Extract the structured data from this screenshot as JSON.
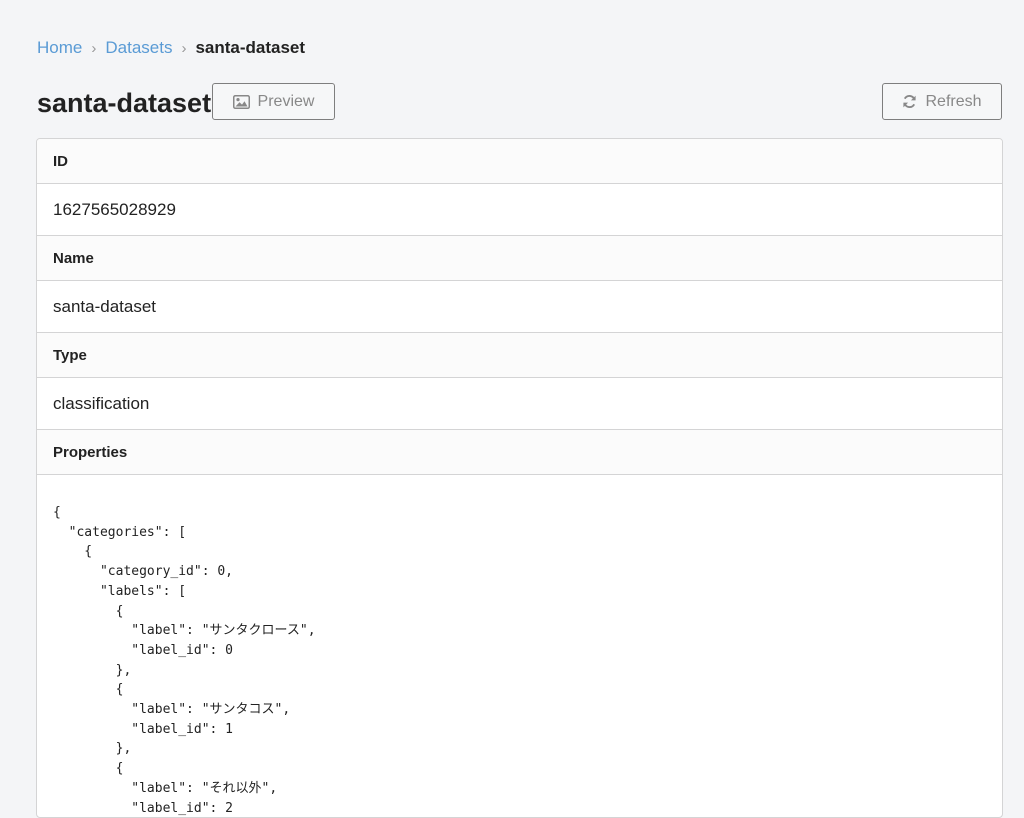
{
  "breadcrumb": {
    "home": "Home",
    "datasets": "Datasets",
    "current": "santa-dataset",
    "separator": "›"
  },
  "header": {
    "title": "santa-dataset",
    "preview_label": "Preview",
    "refresh_label": "Refresh"
  },
  "details": {
    "id_label": "ID",
    "id_value": "1627565028929",
    "name_label": "Name",
    "name_value": "santa-dataset",
    "type_label": "Type",
    "type_value": "classification",
    "properties_label": "Properties"
  },
  "properties_json": "{\n  \"categories\": [\n    {\n      \"category_id\": 0,\n      \"labels\": [\n        {\n          \"label\": \"サンタクロース\",\n          \"label_id\": 0\n        },\n        {\n          \"label\": \"サンタコス\",\n          \"label_id\": 1\n        },\n        {\n          \"label\": \"それ以外\",\n          \"label_id\": 2",
  "icons": {
    "preview": "image-icon",
    "refresh": "refresh-icon"
  },
  "colors": {
    "link": "#5a9bd5",
    "background": "#f4f5f7",
    "border": "#d4d4d5"
  }
}
